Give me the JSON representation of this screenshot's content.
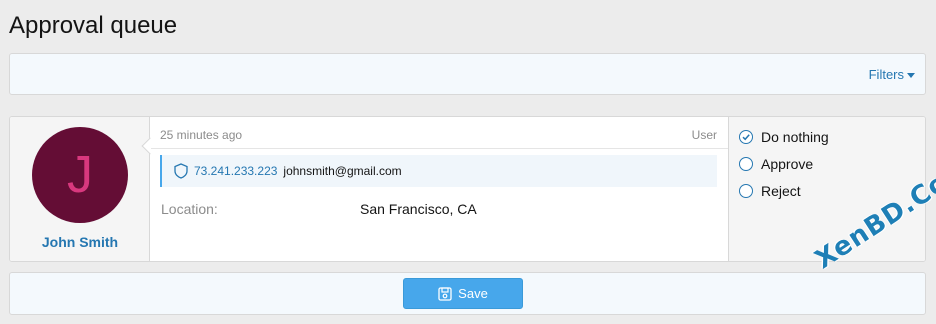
{
  "page": {
    "title": "Approval queue"
  },
  "filters": {
    "label": "Filters"
  },
  "item": {
    "user": {
      "name": "John Smith",
      "avatar_letter": "J",
      "avatar_bg": "#640d35",
      "avatar_fg": "#d8387e"
    },
    "time": "25 minutes ago",
    "type": "User",
    "ip": "73.241.233.223",
    "email": "johnsmith@gmail.com",
    "location_label": "Location:",
    "location_value": "San Francisco, CA"
  },
  "actions": {
    "options": [
      {
        "label": "Do nothing",
        "selected": true
      },
      {
        "label": "Approve",
        "selected": false
      },
      {
        "label": "Reject",
        "selected": false
      }
    ]
  },
  "save": {
    "label": "Save"
  },
  "watermark": {
    "text": "XenBD.Com"
  },
  "colors": {
    "accent": "#2577b1",
    "button": "#47a7eb"
  }
}
